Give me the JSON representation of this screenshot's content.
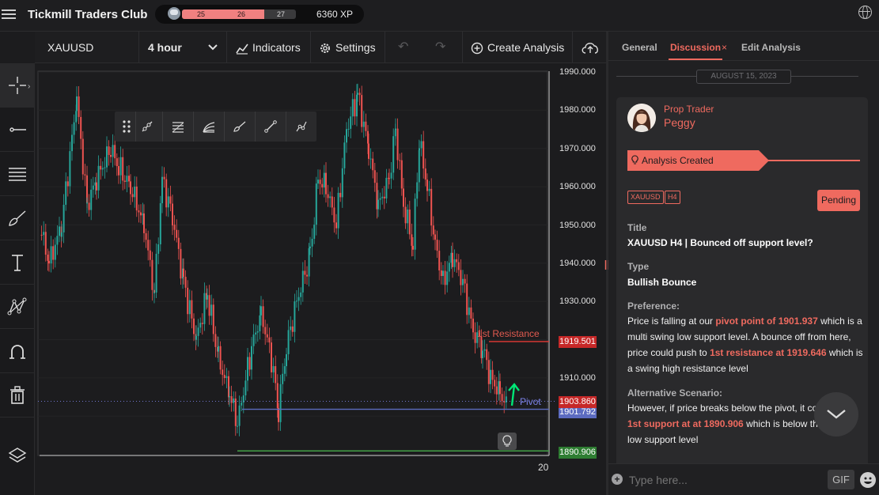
{
  "app": {
    "brand": "Tickmill Traders Club",
    "xp": {
      "current": "25",
      "progress": "26",
      "next": "27",
      "total": "6360 XP",
      "fill_fraction": 0.72
    }
  },
  "toolbar": {
    "symbol": "XAUUSD",
    "timeframe": "4 hour",
    "indicators": "Indicators",
    "settings": "Settings",
    "create_analysis": "Create Analysis"
  },
  "chart": {
    "prices": [
      "1990.000",
      "1980.000",
      "1970.000",
      "1960.000",
      "1950.000",
      "1940.000",
      "1930.000",
      "1920.000",
      "1910.000",
      "1900.000"
    ],
    "badges": {
      "resistance": "1919.501",
      "last": "1903.860",
      "pivot": "1901.792",
      "support": "1890.906"
    },
    "time_label": "20",
    "resistance_label": "1st Resistance",
    "pivot_label": "Pivot",
    "levels": {
      "resistance": 1919.5,
      "pivot": 1901.8,
      "support": 1890.9
    },
    "colors": {
      "up": "#26a69a",
      "down": "#ef5350",
      "resistance": "#e53935",
      "pivot": "#5c6bc0",
      "support": "#43a047"
    }
  },
  "panel": {
    "tabs": {
      "general": "General",
      "discussion": "Discussion",
      "edit": "Edit Analysis"
    },
    "date": "AUGUST 15, 2023",
    "author_role": "Prop Trader",
    "author_name": "Peggy",
    "ribbon": "Analysis Created",
    "chips": [
      "XAUUSD",
      "H4"
    ],
    "status": "Pending",
    "title_label": "Title",
    "title_value": "XAUUSD H4 | Bounced off support level?",
    "type_label": "Type",
    "type_value": "Bullish Bounce",
    "pref_label": "Preference:",
    "pref": {
      "p1": "Price is falling at our ",
      "h1": "pivot point of 1901.937",
      "p2": " which is a multi swing low support level. A bounce off from here, price could push to ",
      "h2": "1st resistance at 1919.646",
      "p3": " which is a swing high resistance level"
    },
    "alt_label": "Alternative Scenario:",
    "alt": {
      "p1": "However, if price breaks below the pivot, it co",
      "h1": "1st support at at 1890.906",
      "p2": " which is below th",
      "p3": "low support level"
    },
    "accent": "#ef6a5f"
  },
  "composer": {
    "placeholder": "Type here...",
    "gif": "GIF"
  }
}
